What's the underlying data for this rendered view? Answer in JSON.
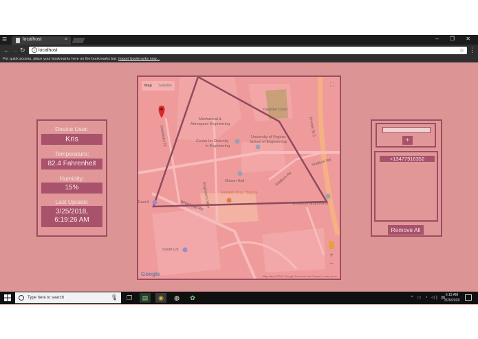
{
  "browser": {
    "tab_title": "localhost",
    "tab_close": "×",
    "url": "localhost",
    "window_controls": "–  ❐  ✕",
    "bookmarks_text": "For quick access, place your bookmarks here on the bookmarks bar.",
    "bookmarks_link": "Import bookmarks now..."
  },
  "device_info": {
    "user_label": "Device User:",
    "user_value": "Kris",
    "temperature_label": "Temperature:",
    "temperature_value": "82.4 Fahrenheit",
    "humidity_label": "Humidity:",
    "humidity_value": "15%",
    "last_update_label": "Last Update:",
    "last_update_date": "3/25/2018,",
    "last_update_time": "6:19:26 AM"
  },
  "map": {
    "tab_map": "Map",
    "tab_satellite": "Satellite",
    "labels": {
      "dawson_court": "Dawson Court",
      "mech_aero_1": "Mechanical &",
      "mech_aero_2": "Aerospace Engineering",
      "center_diversity_1": "Center for Diversity",
      "center_diversity_2": "in Engineering",
      "uva_1": "University of Virginia",
      "uva_2": "School of Engineering",
      "olsson_hall": "Olsson Hall",
      "einstein_bagels": "Einstein Bros. Bagels",
      "woodrow_apartments": "Woodrow Apartments",
      "south_lot": "South Lot",
      "emmet_st": "Emmet St S",
      "stadium_rd_1": "Stadium Rd",
      "stadium_rd_2": "Stadium Rd",
      "engineers_way": "Engineer's Way",
      "whitehead_rd": "Whitehead Rd",
      "chemistry_rd": "Chemistry Dr",
      "east_lot": "East A"
    },
    "google_logo": "Google",
    "footer": "Map data ©2018 Google   Terms of Use   Report a map error",
    "zoom_in": "+",
    "zoom_out": "−"
  },
  "phones": {
    "add_label": "+",
    "numbers": [
      "+13477916352"
    ],
    "remove_all_label": "Remove All"
  },
  "taskbar": {
    "search_placeholder": "Type here to search",
    "time": "6:19 AM",
    "date": "3/25/2018"
  }
}
